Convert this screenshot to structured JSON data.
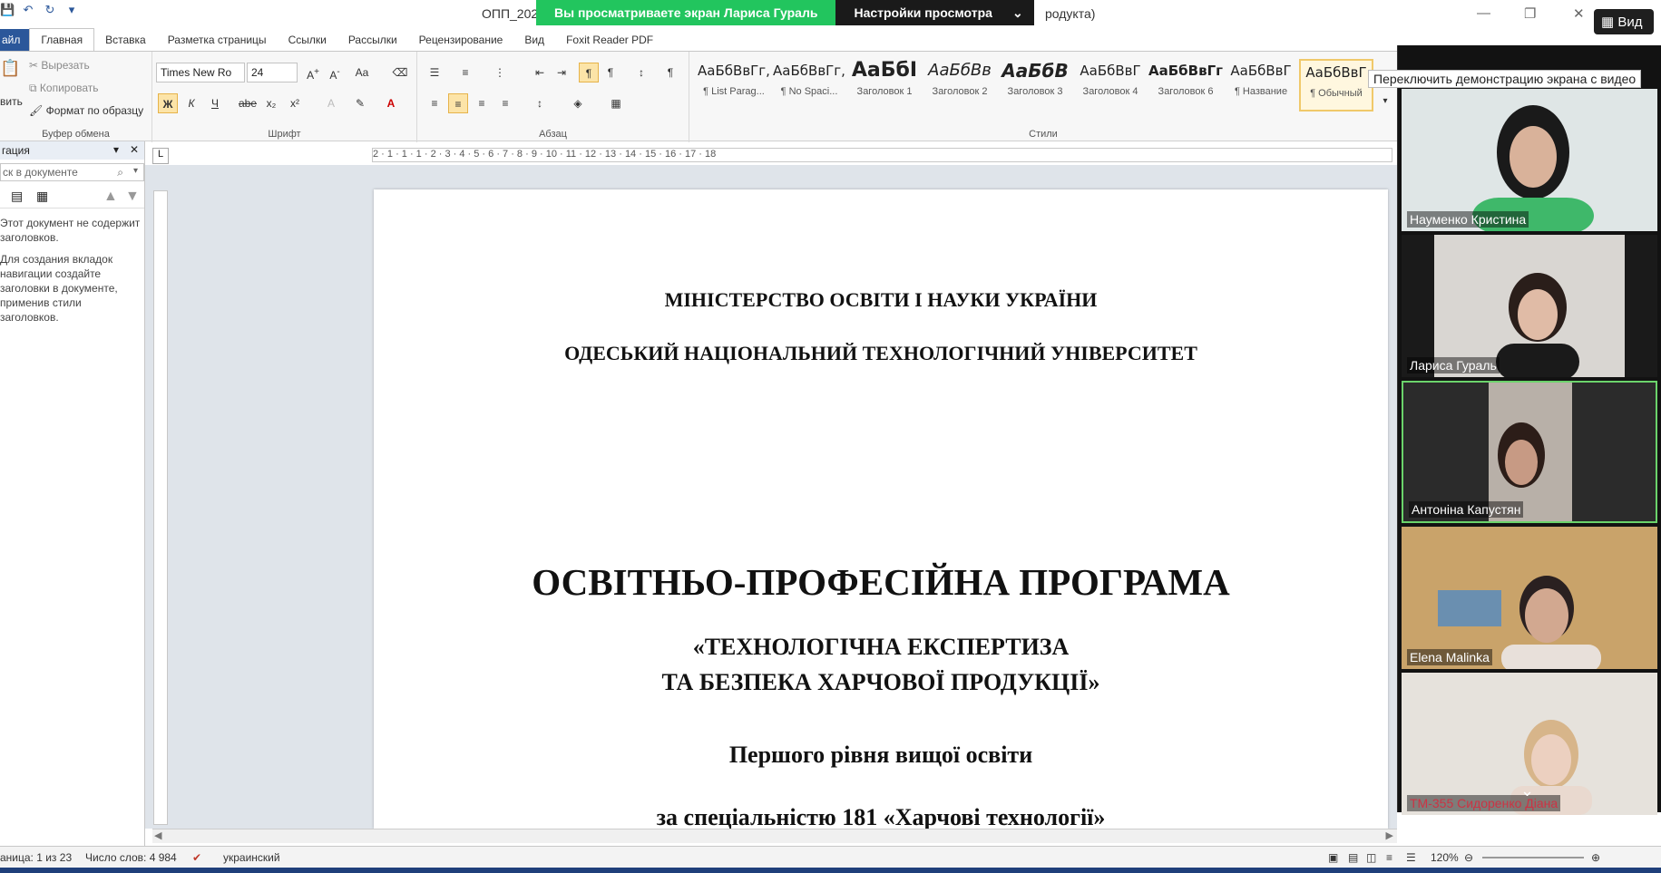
{
  "title_bar": {
    "doc_title_left": "ОПП_202",
    "doc_title_right": "родукта)",
    "banner_text": "Вы просматриваете экран Лариса Гураль",
    "view_settings": "Настройки просмотра",
    "view_button": "Вид"
  },
  "tabs": [
    "айл",
    "Главная",
    "Вставка",
    "Разметка страницы",
    "Ссылки",
    "Рассылки",
    "Рецензирование",
    "Вид",
    "Foxit Reader PDF"
  ],
  "clipboard": {
    "paste": "вить",
    "cut": "Вырезать",
    "copy": "Копировать",
    "format_painter": "Формат по образцу",
    "label": "Буфер обмена"
  },
  "font": {
    "name": "Times New Ro",
    "size": "24",
    "label": "Шрифт",
    "buttons": [
      "Ж",
      "К",
      "Ч",
      "abe",
      "x₂",
      "x²"
    ]
  },
  "paragraph": {
    "label": "Абзац"
  },
  "styles": {
    "label": "Стили",
    "items": [
      {
        "sample": "АаБбВвГг,",
        "name": "¶ List Parag..."
      },
      {
        "sample": "АаБбВвГг,",
        "name": "¶ No Spaci..."
      },
      {
        "sample": "АаБбI",
        "name": "Заголовок 1"
      },
      {
        "sample": "АаБбВв",
        "name": "Заголовок 2"
      },
      {
        "sample": "АаБбВ",
        "name": "Заголовок 3"
      },
      {
        "sample": "АаБбВвГ",
        "name": "Заголовок 4"
      },
      {
        "sample": "АаБбВвГг,",
        "name": "Заголовок 6"
      },
      {
        "sample": "АаБбВвГ",
        "name": "¶ Название"
      },
      {
        "sample": "АаБбВвГ",
        "name": "¶ Обычный"
      }
    ]
  },
  "nav_pane": {
    "title": "гация",
    "search_placeholder": "ск в документе",
    "message_1": "Этот документ не содержит заголовков.",
    "message_2": "Для создания вкладок навигации создайте заголовки в документе, применив стили заголовков."
  },
  "ruler": {
    "h_marks": "2 · 1 · 1 · 1 · 2 · 3 · 4 · 5 · 6 · 7 · 8 · 9 · 10 · 11 · 12 · 13 · 14 · 15 · 16 · 17 · 18",
    "corner": "L"
  },
  "document": {
    "line_1": "МІНІСТЕРСТВО ОСВІТИ І НАУКИ УКРАЇНИ",
    "line_2": "ОДЕСЬКИЙ НАЦІОНАЛЬНИЙ ТЕХНОЛОГІЧНИЙ УНІВЕРСИТЕТ",
    "heading": "ОСВІТНЬО-ПРОФЕСІЙНА ПРОГРАМА",
    "subtitle_1": "«ТЕХНОЛОГІЧНА ЕКСПЕРТИЗА",
    "subtitle_2": "ТА БЕЗПЕКА ХАРЧОВОЇ ПРОДУКЦІЇ»",
    "level": "Першого рівня вищої освіти",
    "specialty": "за спеціальністю 181 «Харчові технології»"
  },
  "status_bar": {
    "page": "аница: 1 из 23",
    "words": "Число слов: 4 984",
    "language": "украинский",
    "zoom": "120%"
  },
  "zoom_panel": {
    "tooltip": "Переключить демонстрацию экрана с видео",
    "participants": [
      {
        "name": "Науменко Кристина",
        "bg": "#dfe6e6",
        "shirt": "#3fb86a"
      },
      {
        "name": "Лариса Гураль",
        "bg": "#d9d6d2",
        "shirt": "#1a1a1a"
      },
      {
        "name": "Антоніна Капустян",
        "bg": "#b8b0a8",
        "shirt": "#5a4a46"
      },
      {
        "name": "Elena Malinka",
        "bg": "#c9a36a",
        "shirt": "#e8e0da"
      },
      {
        "name": "ТМ-355 Сидоренко Діана",
        "bg": "#e6e2dc",
        "shirt": "#e9d9cf"
      }
    ]
  },
  "colors": {
    "word_blue": "#2b579a",
    "banner_green": "#22c55e",
    "zoom_bg": "#121212",
    "active_speaker": "#6bd36b"
  }
}
